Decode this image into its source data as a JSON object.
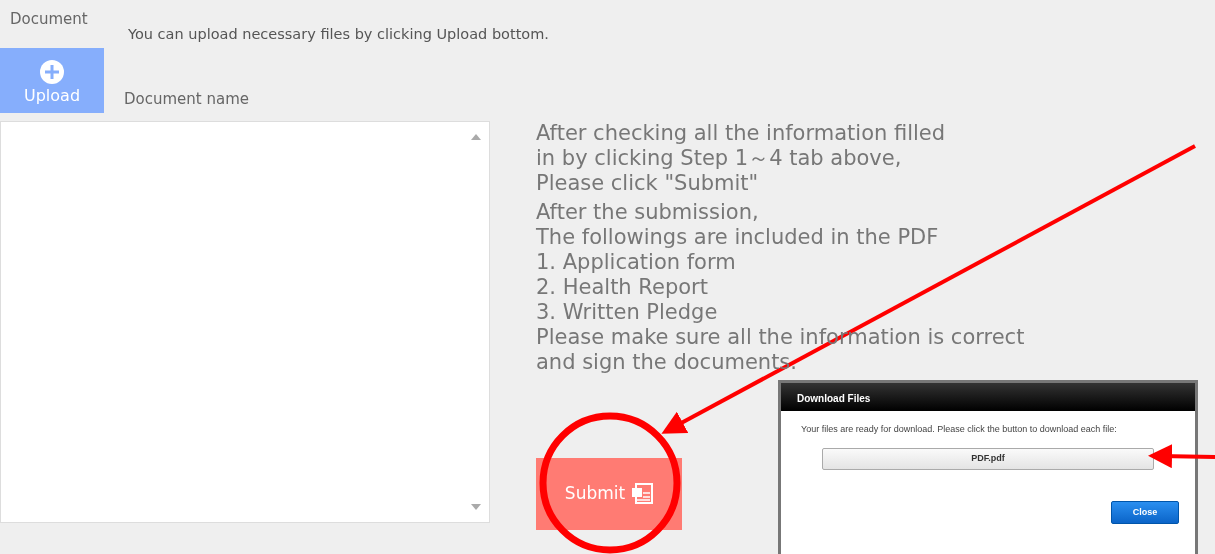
{
  "section_label": "Document",
  "hint": "You can upload necessary files by clicking Upload bottom.",
  "upload_button": {
    "label": "Upload"
  },
  "document_list": {
    "column_header": "Document name"
  },
  "instructions": [
    "After checking all the information filled",
    "in by clicking Step 1～4 tab above,",
    "Please click \"Submit\"",
    "After the submission,",
    "The followings are included in the PDF",
    "1. Application form",
    "2. Health Report",
    "3. Written Pledge",
    "Please make sure all the information is correct",
    "and sign the documents."
  ],
  "submit_button": {
    "label": "Submit"
  },
  "dialog": {
    "title": "Download Files",
    "message": "Your files are ready for download. Please click the button to download each file:",
    "files": [
      "PDF.pdf"
    ],
    "close_button": "Close"
  }
}
